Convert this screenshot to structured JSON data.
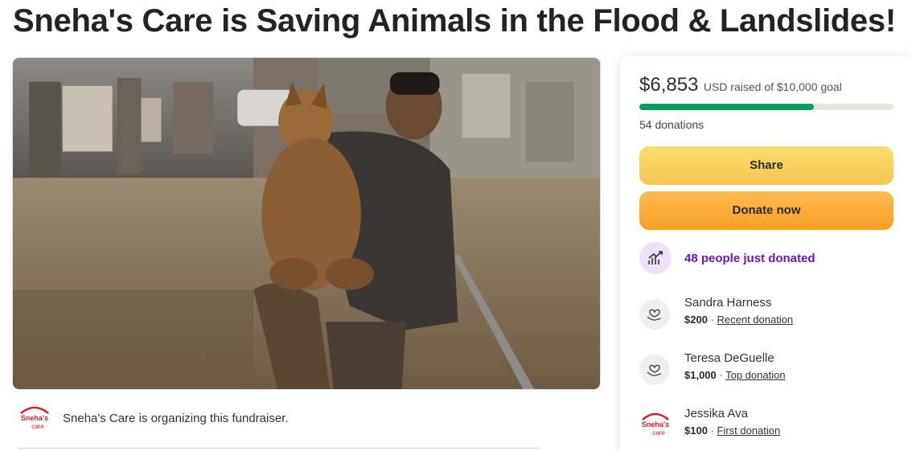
{
  "page": {
    "title": "Sneha's Care is Saving Animals in the Flood & Landslides!"
  },
  "hero": {
    "image_desc": "rescue-photo"
  },
  "organizer": {
    "logo_text_1": "Sneha's",
    "logo_text_2": "care",
    "text": "Sneha's Care is organizing this fundraiser."
  },
  "panel": {
    "amount": "$6,853",
    "amount_sub": "USD raised of $10,000 goal",
    "progress_fraction": 0.6853,
    "donations_count": "54 donations",
    "share_label": "Share",
    "donate_label": "Donate now",
    "trend_text": "48 people just donated",
    "donors": [
      {
        "name": "Sandra Harness",
        "amount": "$200",
        "separator": " · ",
        "tag": "Recent donation"
      },
      {
        "name": "Teresa DeGuelle",
        "amount": "$1,000",
        "separator": " · ",
        "tag": "Top donation"
      },
      {
        "name": "Jessika Ava",
        "amount": "$100",
        "separator": " · ",
        "tag": "First donation"
      }
    ]
  },
  "colors": {
    "accent_green": "#00a160",
    "share_yellow": "#f6c84e",
    "donate_orange": "#f7a022",
    "trend_purple": "#6b17b8"
  }
}
